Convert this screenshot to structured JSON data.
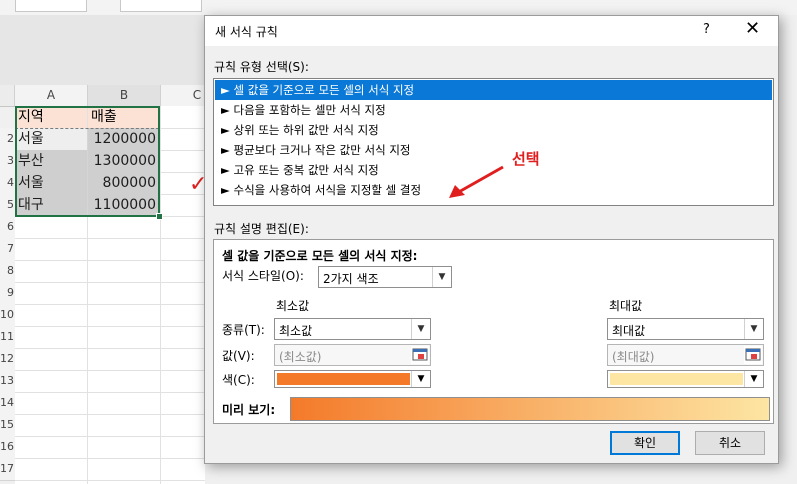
{
  "spreadsheet": {
    "columns": [
      "A",
      "B",
      "C"
    ],
    "rows": [
      "2",
      "3",
      "4",
      "5",
      "6",
      "7",
      "8",
      "9",
      "10",
      "11",
      "12",
      "13",
      "14",
      "15",
      "16",
      "17"
    ],
    "header": {
      "region": "지역",
      "sales": "매출"
    },
    "data": [
      {
        "region": "서울",
        "sales": "1200000"
      },
      {
        "region": "부산",
        "sales": "1300000"
      },
      {
        "region": "서울",
        "sales": "800000"
      },
      {
        "region": "대구",
        "sales": "1100000"
      }
    ],
    "annotation_check": "✓"
  },
  "dialog": {
    "title": "새 서식 규칙",
    "help": "?",
    "close": "✕",
    "rule_type_label": "규칙 유형 선택(S):",
    "rule_types": [
      "► 셀 값을 기준으로 모든 셀의 서식 지정",
      "► 다음을 포함하는 셀만 서식 지정",
      "► 상위 또는 하위 값만 서식 지정",
      "► 평균보다 크거나 작은 값만 서식 지정",
      "► 고유 또는 중복 값만 서식 지정",
      "► 수식을 사용하여 서식을 지정할 셀 결정"
    ],
    "selected_rule_index": 0,
    "annotation_text": "선택",
    "edit_label": "규칙 설명 편집(E):",
    "edit_heading": "셀 값을 기준으로 모든 셀의 서식 지정:",
    "format_style_label": "서식 스타일(O):",
    "format_style_value": "2가지 색조",
    "min_header": "최소값",
    "max_header": "최대값",
    "type_label": "종류(T):",
    "value_label": "값(V):",
    "color_label": "색(C):",
    "min_type": "최소값",
    "max_type": "최대값",
    "min_value_placeholder": "(최소값)",
    "max_value_placeholder": "(최대값)",
    "min_color": "#f47a2a",
    "max_color": "#fde5a3",
    "preview_label": "미리 보기:",
    "ok": "확인",
    "cancel": "취소"
  }
}
